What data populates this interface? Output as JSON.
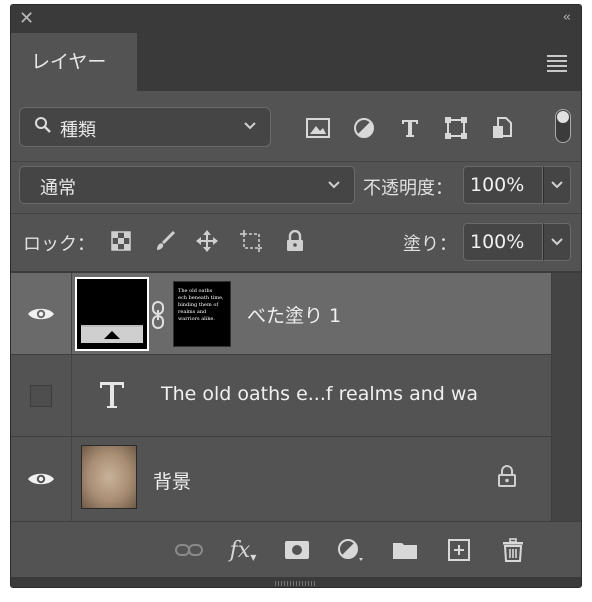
{
  "window": {
    "close_glyph": "✕",
    "collapse_glyph": "‹‹"
  },
  "tabs": [
    {
      "label": "レイヤー",
      "active": true
    }
  ],
  "filter": {
    "kind_label": "種類",
    "icons": [
      "image-filter-icon",
      "adjustment-filter-icon",
      "type-filter-icon",
      "shape-filter-icon",
      "smart-object-filter-icon"
    ]
  },
  "blend": {
    "mode": "通常",
    "opacity_label": "不透明度：",
    "opacity_value": "100%"
  },
  "lock": {
    "label": "ロック：",
    "icons": [
      "lock-transparent-pixels-icon",
      "lock-image-pixels-icon",
      "lock-position-icon",
      "lock-artboard-icon",
      "lock-all-icon"
    ],
    "fill_label": "塗り：",
    "fill_value": "100%"
  },
  "layers": [
    {
      "name": "べた塗り 1",
      "visible": true,
      "selected": true,
      "type": "fill",
      "mask_text": "The old oaths\nech beneath time,\nbinding them of\nrealms and\nwarriors alike."
    },
    {
      "name": "The old oaths e...f realms and wa",
      "visible": false,
      "selected": false,
      "type": "text"
    },
    {
      "name": "背景",
      "visible": true,
      "selected": false,
      "type": "background",
      "locked": true
    }
  ],
  "footer_tools": [
    "link-layers-icon",
    "fx-icon",
    "add-mask-icon",
    "new-adjustment-layer-icon",
    "new-group-icon",
    "new-layer-icon",
    "delete-layer-icon"
  ],
  "fx_label": "fx"
}
